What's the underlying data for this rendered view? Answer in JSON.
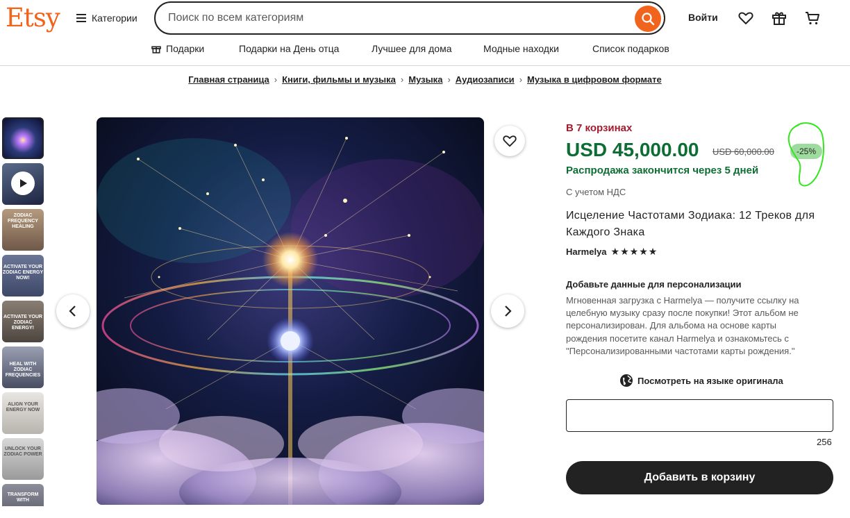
{
  "header": {
    "logo": "Etsy",
    "categories_label": "Категории",
    "search_placeholder": "Поиск по всем категориям",
    "signin_label": "Войти",
    "icons": [
      "menu-icon",
      "search-icon",
      "heart-icon",
      "gift-icon",
      "cart-icon"
    ]
  },
  "nav": {
    "items": [
      "Подарки",
      "Подарки на День отца",
      "Лучшее для дома",
      "Модные находки",
      "Список подарков"
    ]
  },
  "breadcrumb": [
    "Главная страница",
    "Книги, фильмы и музыка",
    "Музыка",
    "Аудиозаписи",
    "Музыка в цифровом формате"
  ],
  "thumbnails": [
    {
      "text": ""
    },
    {
      "text": ""
    },
    {
      "text": "ZODIAC FREQUENCY HEALING"
    },
    {
      "text": "ACTIVATE YOUR ZODIAC ENERGY NOW!"
    },
    {
      "text": "ACTIVATE YOUR ZODIAC ENERGY!"
    },
    {
      "text": "HEAL WITH ZODIAC FREQUENCIES"
    },
    {
      "text": "ALIGN YOUR ENERGY NOW"
    },
    {
      "text": "UNLOCK YOUR ZODIAC POWER"
    },
    {
      "text": "TRANSFORM WITH"
    }
  ],
  "product": {
    "in_carts": "В 7 корзинах",
    "price": "USD 45,000.00",
    "old_price": "USD 60,000.00",
    "discount": "-25%",
    "sale_text": "Распродажа закончится через 5 дней",
    "vat": "С учетом НДС",
    "title": "Исцеление Частотами Зодиака: 12 Треков для Каждого Знака",
    "shop": "Harmelya",
    "rating": 5,
    "stars": "★★★★★",
    "personalization_heading": "Добавьте данные для персонализации",
    "personalization_text": "Мгновенная загрузка с Harmelya — получите ссылку на целебную музыку сразу после покупки! Этот альбом не персонализирован. Для альбома на основе карты рождения посетите канал Harmelya и ознакомьтесь с \"Персонализированными частотами карты рождения.\"",
    "translate_label": "Посмотреть на языке оригинала",
    "char_counter": "256",
    "add_to_cart": "Добавить в корзину"
  },
  "colors": {
    "brand": "#f1641e",
    "price_green": "#0e6d35",
    "carts_red": "#a61a2e",
    "badge_green": "#9edb9e",
    "annotation_green": "#33e61e"
  }
}
